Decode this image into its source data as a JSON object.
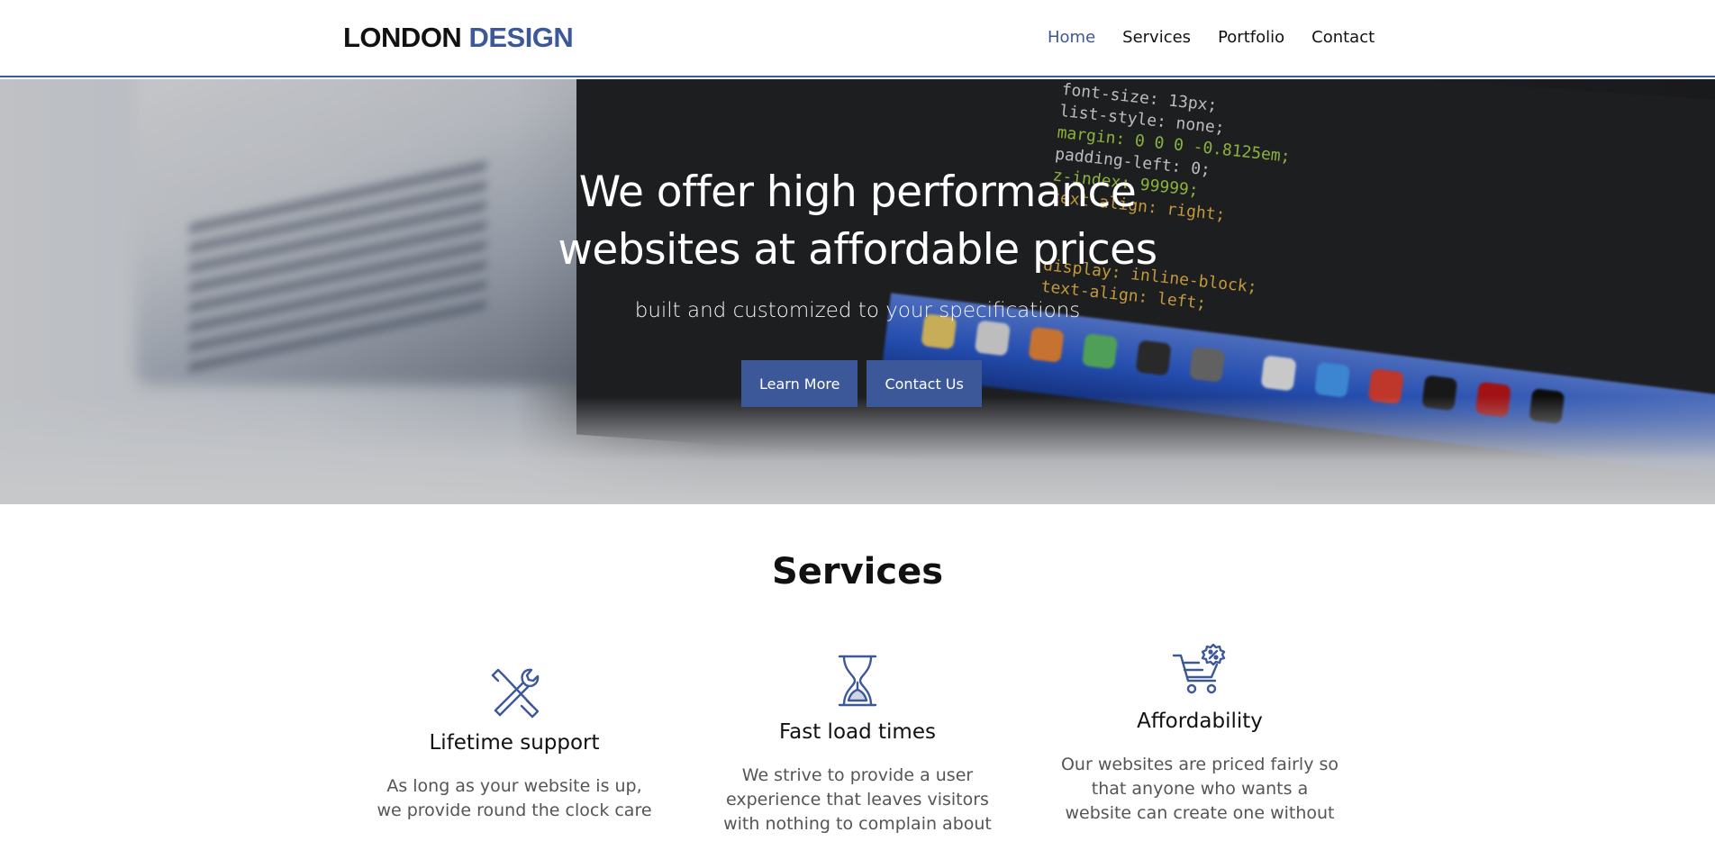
{
  "brand": {
    "part1": "LONDON",
    "part2": "DESIGN",
    "accent_color": "#3d5898"
  },
  "nav": {
    "items": [
      {
        "label": "Home",
        "active": true
      },
      {
        "label": "Services",
        "active": false
      },
      {
        "label": "Portfolio",
        "active": false
      },
      {
        "label": "Contact",
        "active": false
      }
    ]
  },
  "hero": {
    "title_line1": "We offer high performance",
    "title_line2": "websites at affordable prices",
    "subtitle": "built and customized to your specifications",
    "learn_more_label": "Learn More",
    "contact_us_label": "Contact Us",
    "code_lines": [
      "font-size: 13px;",
      "list-style: none;",
      "margin: 0 0 0 -0.8125em;",
      "padding-left: 0;",
      "z-index: 99999;",
      "text-align: right;",
      "display: inline-block;",
      "text-align: left;"
    ]
  },
  "services": {
    "title": "Services",
    "items": [
      {
        "icon": "tools-icon",
        "title": "Lifetime support",
        "text_line1": "As long as your website is up,",
        "text_line2": "we provide round the clock care"
      },
      {
        "icon": "hourglass-icon",
        "title": "Fast load times",
        "text_line1": "We strive to provide a user",
        "text_line2": "experience that leaves visitors",
        "text_line3": "with nothing to complain about"
      },
      {
        "icon": "cart-discount-icon",
        "title": "Affordability",
        "text_line1": "Our websites are priced fairly so",
        "text_line2": "that anyone who wants a",
        "text_line3": "website can create one without"
      }
    ]
  }
}
